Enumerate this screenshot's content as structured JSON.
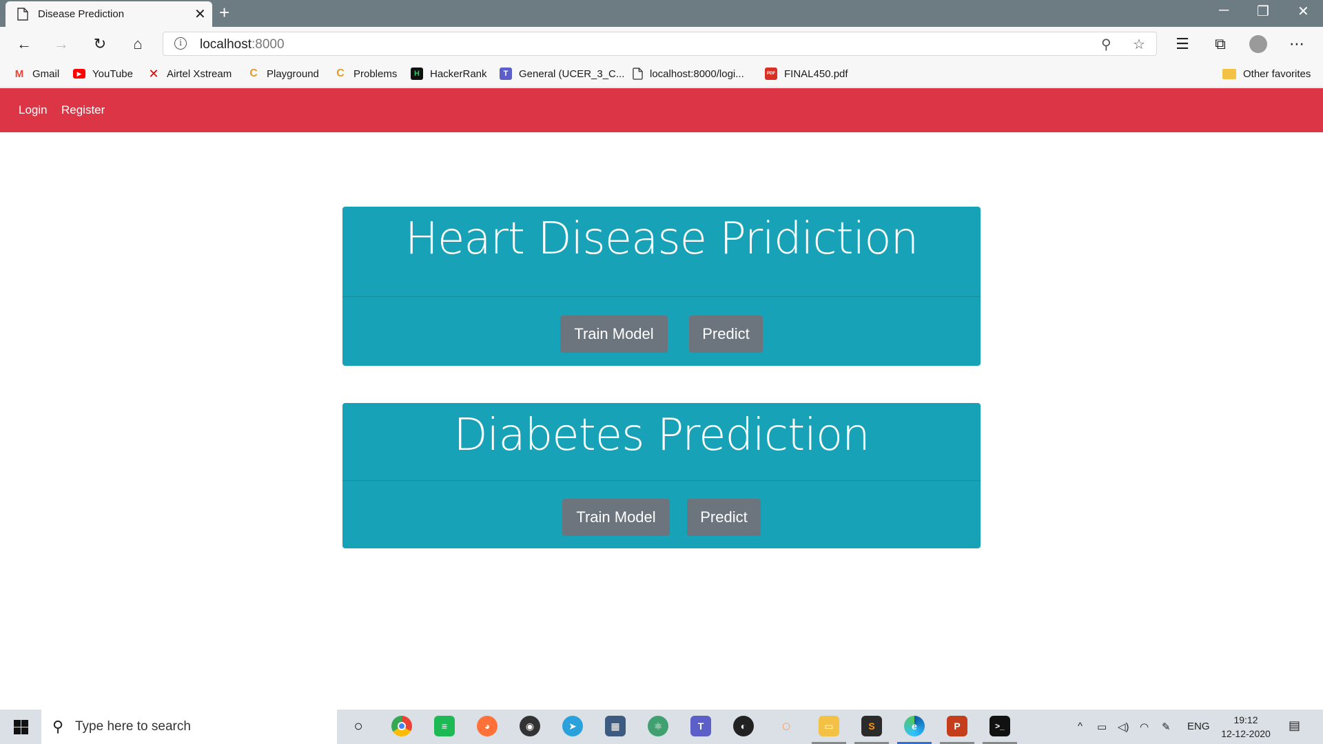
{
  "browser": {
    "tab_title": "Disease Prediction",
    "tab_close": "✕",
    "new_tab": "+",
    "window_controls": [
      "─",
      "❐",
      "✕"
    ],
    "url_host": "localhost",
    "url_port": ":8000",
    "bookmarks": [
      {
        "label": "Gmail",
        "icon": "gmail-icon",
        "glyph": "M",
        "color": "#ea4335"
      },
      {
        "label": "YouTube",
        "icon": "youtube-icon",
        "glyph": "▶",
        "color": "#ff0000"
      },
      {
        "label": "Airtel Xstream",
        "icon": "airtel-icon",
        "glyph": "✕",
        "color": "#e40000"
      },
      {
        "label": "Playground",
        "icon": "leetcode-icon",
        "glyph": "C",
        "color": "#e69a28"
      },
      {
        "label": "Problems",
        "icon": "leetcode-icon",
        "glyph": "C",
        "color": "#e69a28"
      },
      {
        "label": "HackerRank",
        "icon": "hackerrank-icon",
        "glyph": "H",
        "color": "#111111"
      },
      {
        "label": "General (UCER_3_C...",
        "icon": "teams-icon",
        "glyph": "T",
        "color": "#5b5fc7"
      },
      {
        "label": "localhost:8000/logi...",
        "icon": "page-icon",
        "glyph": "",
        "color": "#ffffff"
      },
      {
        "label": "FINAL450.pdf",
        "icon": "pdf-icon",
        "glyph": "PDF",
        "color": "#d93025"
      }
    ],
    "other_favorites": "Other favorites"
  },
  "site": {
    "nav": {
      "login": "Login",
      "register": "Register"
    },
    "cards": [
      {
        "title": "Heart Disease Pridiction",
        "train_label": "Train Model",
        "predict_label": "Predict"
      },
      {
        "title": "Diabetes Prediction",
        "train_label": "Train Model",
        "predict_label": "Predict"
      }
    ],
    "colors": {
      "navbar": "#dc3545",
      "card": "#17a2b8",
      "button": "#6c757d"
    }
  },
  "taskbar": {
    "search_placeholder": "Type here to search",
    "language": "ENG",
    "time": "19:12",
    "date": "12-12-2020",
    "apps": [
      "cortana-icon",
      "chrome-icon",
      "spotify-icon",
      "firefox-icon",
      "obs-icon",
      "telegram-icon",
      "calculator-icon",
      "atom-icon",
      "teams-icon",
      "github-icon",
      "jupyter-icon",
      "file-explorer-icon",
      "sublime-icon",
      "edge-icon",
      "powerpoint-icon",
      "terminal-icon"
    ]
  }
}
